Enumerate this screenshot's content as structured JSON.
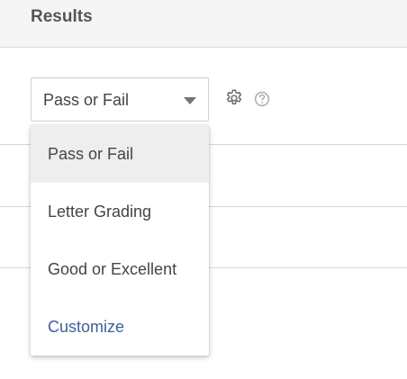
{
  "header": {
    "title": "Results"
  },
  "grading_select": {
    "value": "Pass or Fail",
    "options": [
      {
        "label": "Pass or Fail",
        "selected": true
      },
      {
        "label": "Letter Grading",
        "selected": false
      },
      {
        "label": "Good or Excellent",
        "selected": false
      }
    ],
    "customize_label": "Customize"
  },
  "icons": {
    "settings": "gear-icon",
    "help": "question-circle-icon"
  },
  "colors": {
    "link": "#3f5f9a",
    "selected_bg": "#eeeeee",
    "header_bg": "#f5f5f5"
  }
}
